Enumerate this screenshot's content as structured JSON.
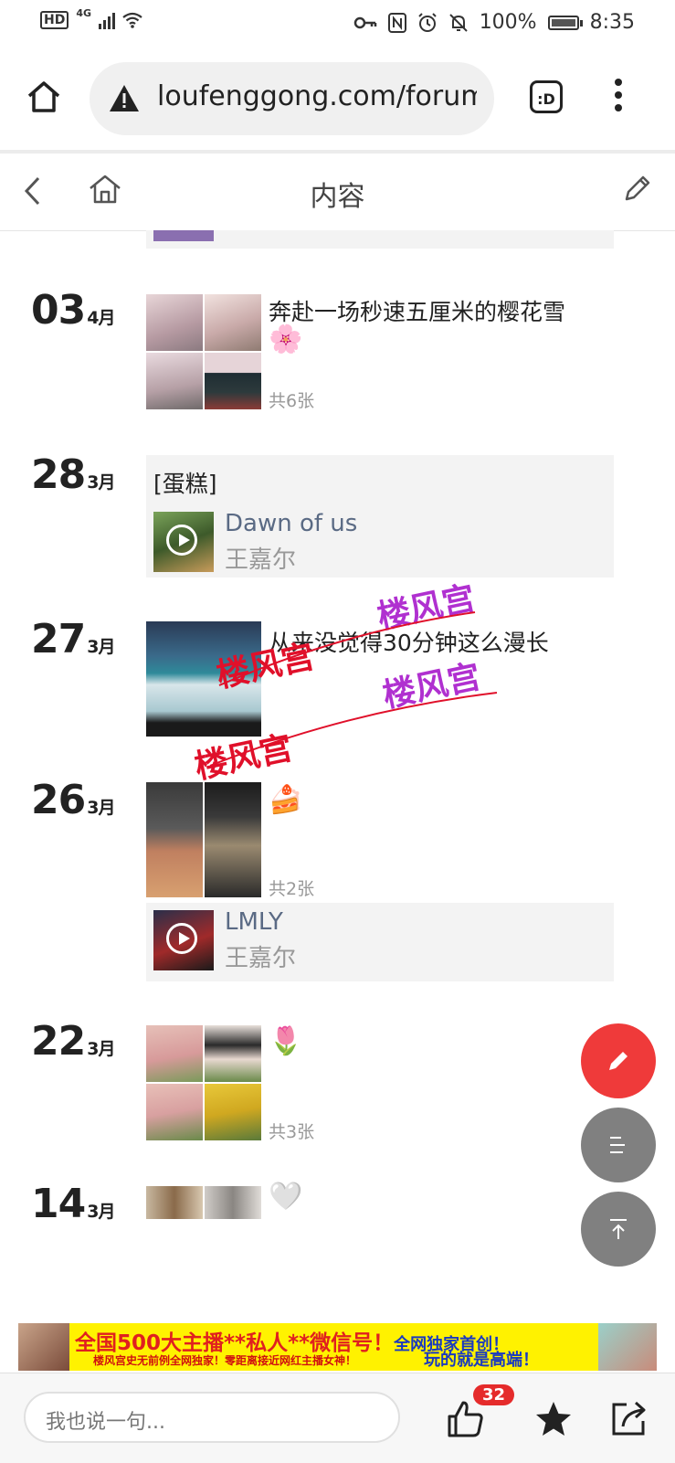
{
  "status_bar": {
    "hd": "HD",
    "network": "4G",
    "battery": "100%",
    "time": "8:35"
  },
  "browser": {
    "url": "loufenggong.com/forum",
    "tab_badge": ":D"
  },
  "forum_header": {
    "title": "内容"
  },
  "posts": [
    {
      "day": "03",
      "month": "4月",
      "text": "奔赴一场秒速五厘米的樱花雪",
      "emoji": "🌸",
      "count": "共6张"
    },
    {
      "day": "28",
      "month": "3月",
      "text": "[蛋糕]",
      "song": "Dawn of us",
      "artist": "王嘉尔"
    },
    {
      "day": "27",
      "month": "3月",
      "text": "从来没觉得30分钟这么漫长"
    },
    {
      "day": "26",
      "month": "3月",
      "emoji": "🍰",
      "count": "共2张",
      "song": "LMLY",
      "artist": "王嘉尔"
    },
    {
      "day": "22",
      "month": "3月",
      "emoji": "🌷",
      "count": "共3张"
    },
    {
      "day": "14",
      "month": "3月",
      "emoji": "🤍"
    }
  ],
  "watermark": "楼风宫",
  "banner": {
    "line1_part1": "全国500大主播**私人**微信号！",
    "line1_part2": "全网独家首创！",
    "line1_part3": "玩的就是高端！",
    "line2": "楼风宫史无前例全网独家！零距离接近网红主播女神！"
  },
  "bottom_bar": {
    "placeholder": "我也说一句...",
    "like_count": "32"
  },
  "colors": {
    "fab_red": "#ef3a3a",
    "fab_gray": "#808080",
    "banner_bg": "#fff200",
    "badge": "#e52b2b",
    "watermark_red": "#e0102a",
    "watermark_purple": "#b030d0"
  },
  "icons": [
    "home-icon",
    "warning-icon",
    "tab-switcher-icon",
    "more-menu-icon",
    "back-icon",
    "forum-home-icon",
    "edit-icon",
    "play-icon",
    "pencil-icon",
    "list-icon",
    "top-icon",
    "like-icon",
    "star-icon",
    "share-icon"
  ]
}
